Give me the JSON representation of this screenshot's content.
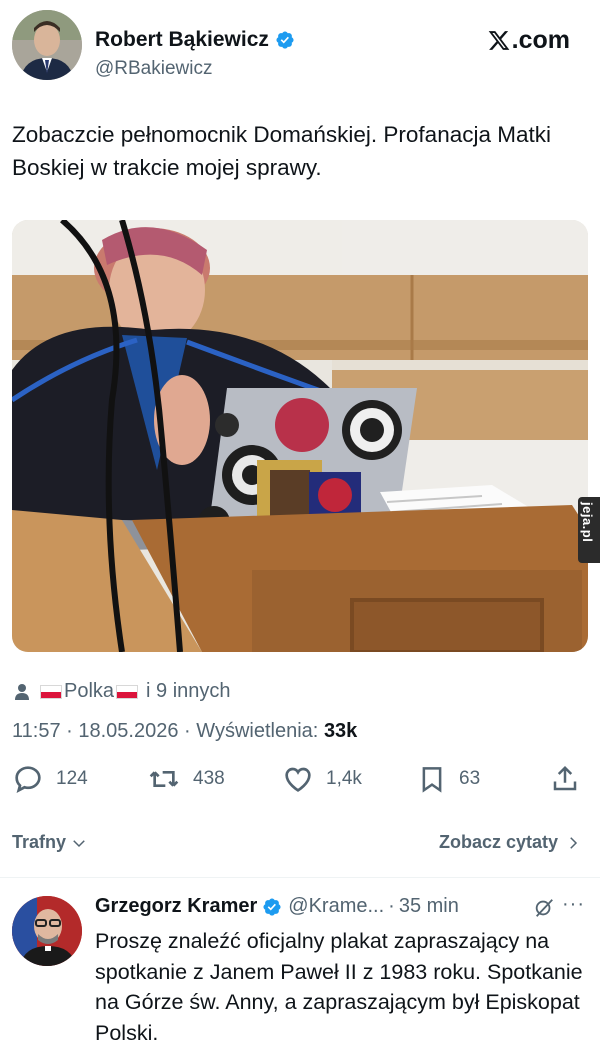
{
  "author": {
    "name": "Robert Bąkiewicz",
    "handle": "@RBakiewicz",
    "avatar": "person-avatar"
  },
  "brand": {
    "label": ".com",
    "icon": "x-logo-icon"
  },
  "tweet": {
    "text": "Zobaczcie pełnomocnik Domańskiej. Profanacja Matki Boskiej w trakcie mojej sprawy.",
    "image": "courtroom-photo"
  },
  "watermark": {
    "label": "jeja.pl"
  },
  "liked_by": {
    "name": "Polka",
    "others": "i 9 innych"
  },
  "meta": {
    "time": "11:57",
    "date": "18.05.2026",
    "views_label": "Wyświetlenia:",
    "views": "33k",
    "sep": "·"
  },
  "actions": {
    "replies": "124",
    "reposts": "438",
    "likes": "1,4k",
    "bookmarks": "63"
  },
  "sort": {
    "label": "Trafny",
    "quotes_label": "Zobacz cytaty"
  },
  "reply": {
    "name": "Grzegorz Kramer",
    "handle": "@Krame...",
    "time": "35 min",
    "more": "···",
    "text": "Proszę znaleźć oficjalny plakat zapraszający na spotkanie z Janem Paweł II z 1983 roku. Spotkanie na Górze św. Anny, a zapraszającym był Episkopat Polski."
  },
  "colors": {
    "verified": "#1d9bf0",
    "text": "#0f1419",
    "muted": "#536471"
  }
}
